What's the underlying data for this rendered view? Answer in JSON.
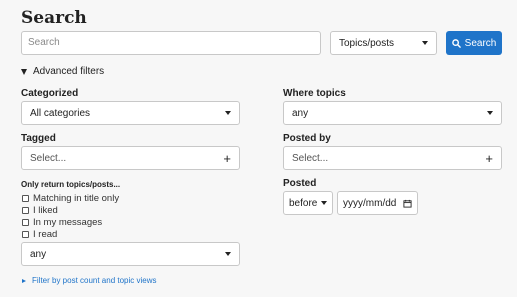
{
  "page_title": "Search",
  "search": {
    "placeholder": "Search",
    "type_select": "Topics/posts",
    "button_label": "Search"
  },
  "advanced": {
    "toggle_label": "Advanced filters",
    "categorized_label": "Categorized",
    "categorized_value": "All categories",
    "where_label": "Where topics",
    "where_value": "any",
    "tagged_label": "Tagged",
    "tagged_placeholder": "Select...",
    "posted_by_label": "Posted by",
    "posted_by_placeholder": "Select...",
    "only_return_label": "Only return topics/posts...",
    "checkboxes": [
      "Matching in title only",
      "I liked",
      "In my messages",
      "I read"
    ],
    "only_return_value": "any",
    "posted_label": "Posted",
    "posted_when": "before",
    "date_placeholder": "yyyy/mm/dd",
    "filter_link": "Filter by post count and topic views"
  },
  "colors": {
    "accent": "#1f74c9",
    "background": "#f7f7f7"
  }
}
